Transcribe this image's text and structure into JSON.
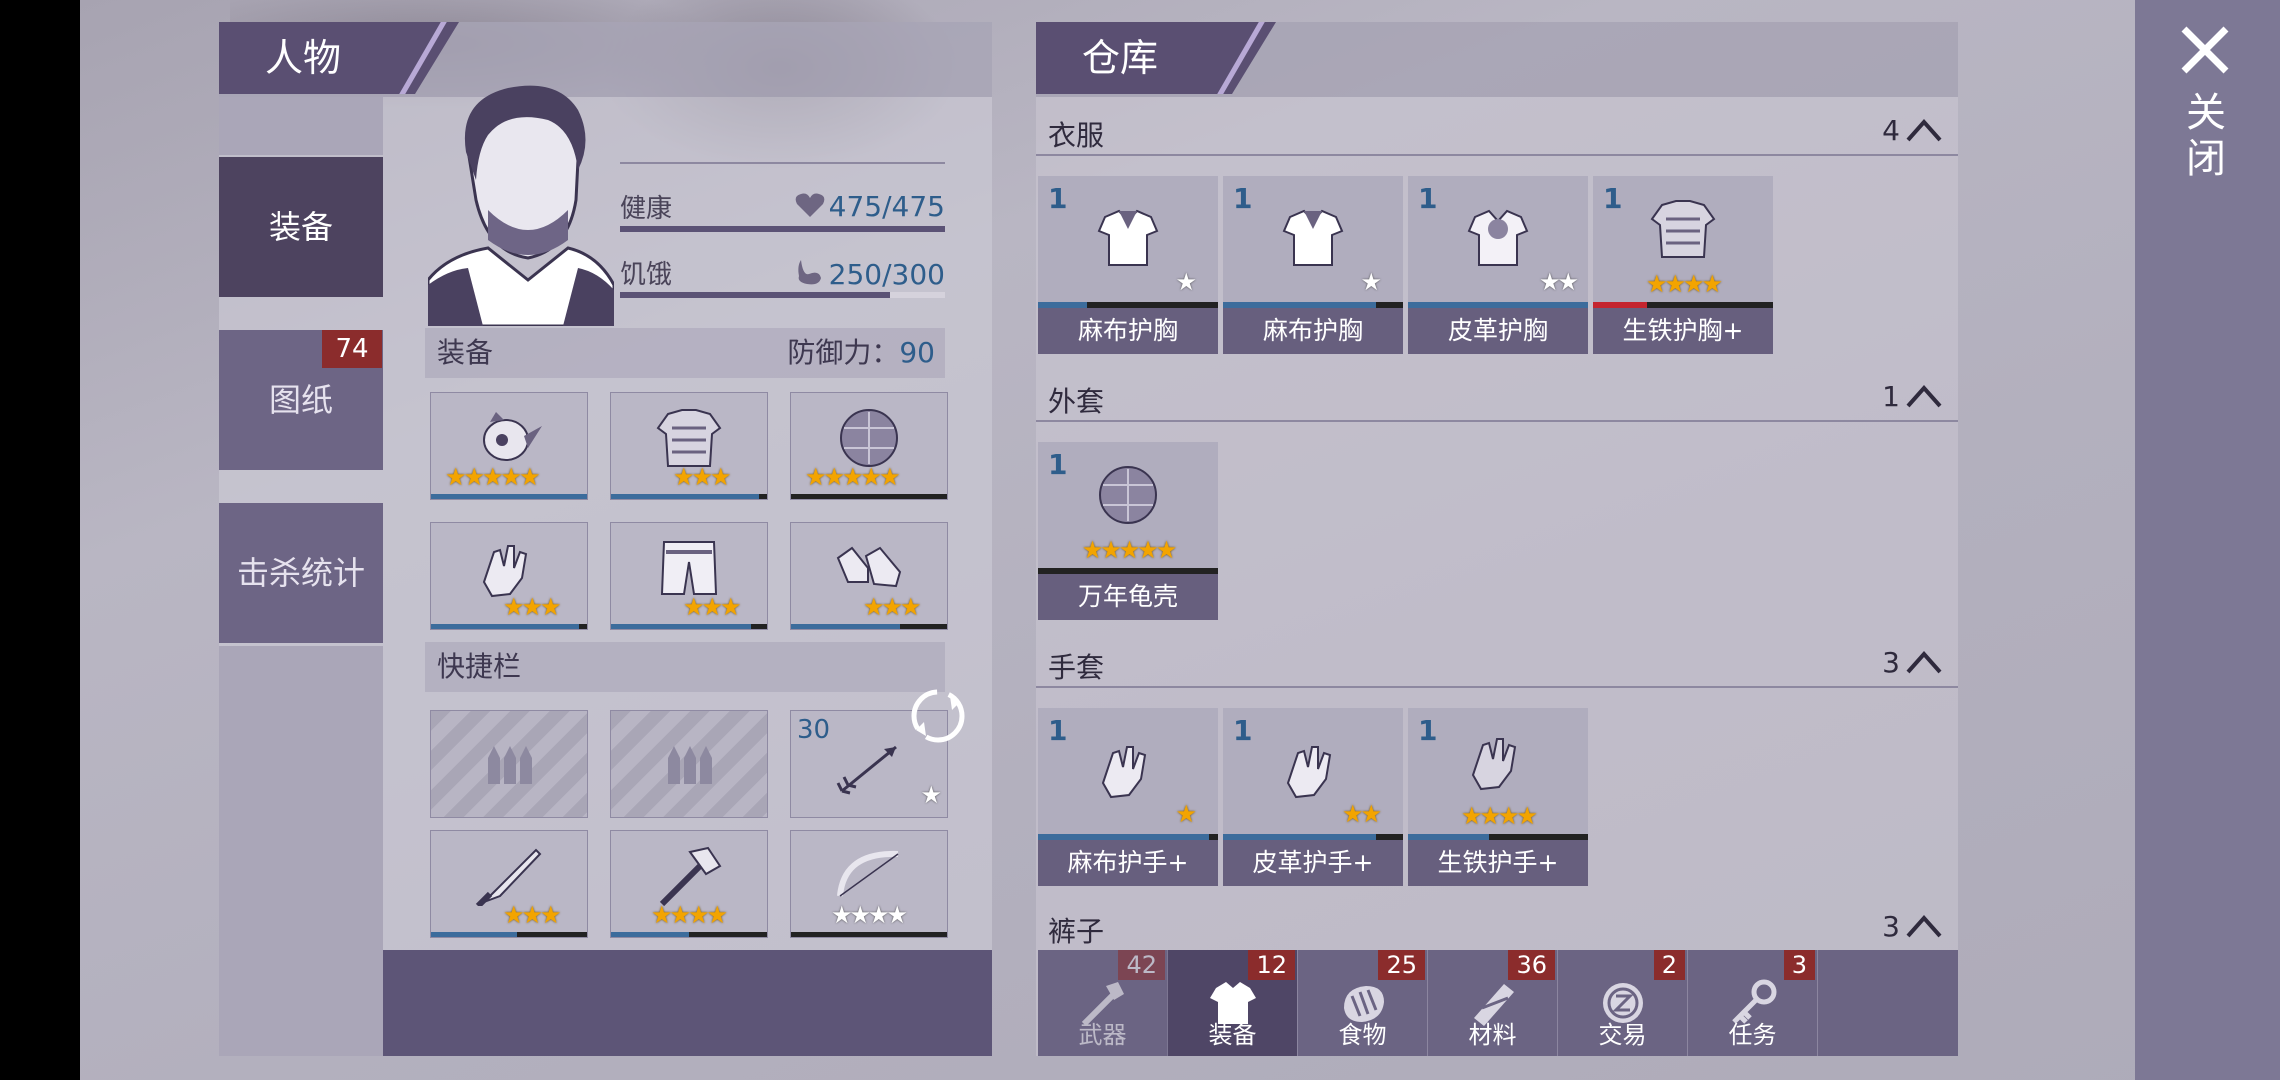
{
  "character": {
    "title": "人物",
    "tabs": [
      {
        "label": "装备"
      },
      {
        "label": "图纸",
        "badge": "74"
      },
      {
        "label": "击杀统计"
      }
    ],
    "stats": {
      "health": {
        "label": "健康",
        "value": "475/475",
        "level": 1.0
      },
      "hunger": {
        "label": "饥饿",
        "value": "250/300",
        "level": 0.833
      }
    },
    "equipment": {
      "label": "装备",
      "defense_label": "防御力：",
      "defense_value": "90",
      "slots": [
        {
          "icon": "bird-helmet-icon",
          "stars": "★★★★★"
        },
        {
          "icon": "chest-armor-icon",
          "stars": "★★★"
        },
        {
          "icon": "turtle-shell-icon",
          "stars": "★★★★★"
        },
        {
          "icon": "gloves-icon",
          "stars": "★★★"
        },
        {
          "icon": "pants-icon",
          "stars": "★★★"
        },
        {
          "icon": "shoes-icon",
          "stars": "★★★"
        }
      ]
    },
    "quickbar": {
      "label": "快捷栏",
      "slots": [
        {
          "icon": "ammo-placeholder-icon"
        },
        {
          "icon": "ammo-placeholder-icon"
        },
        {
          "icon": "arrow-icon",
          "count": "30",
          "stars": "★"
        },
        {
          "icon": "machete-icon",
          "stars": "★★★"
        },
        {
          "icon": "axe-icon",
          "stars": "★★★★"
        },
        {
          "icon": "bow-icon",
          "stars": "★★★★"
        }
      ]
    }
  },
  "storage": {
    "title": "仓库",
    "categories": [
      {
        "name": "衣服",
        "count": "4",
        "items": [
          {
            "qty": "1",
            "name": "麻布护胸",
            "stars": "★"
          },
          {
            "qty": "1",
            "name": "麻布护胸",
            "stars": "★"
          },
          {
            "qty": "1",
            "name": "皮革护胸",
            "stars": "★★"
          },
          {
            "qty": "1",
            "name": "生铁护胸+",
            "stars": "★★★★"
          }
        ]
      },
      {
        "name": "外套",
        "count": "1",
        "items": [
          {
            "qty": "1",
            "name": "万年龟壳",
            "stars": "★★★★★"
          }
        ]
      },
      {
        "name": "手套",
        "count": "3",
        "items": [
          {
            "qty": "1",
            "name": "麻布护手+",
            "stars": "★"
          },
          {
            "qty": "1",
            "name": "皮革护手+",
            "stars": "★★"
          },
          {
            "qty": "1",
            "name": "生铁护手+",
            "stars": "★★★★"
          }
        ]
      },
      {
        "name": "裤子",
        "count": "3",
        "items": []
      }
    ],
    "bottom_tabs": [
      {
        "label": "武器",
        "badge": "42",
        "icon": "hatchet-icon"
      },
      {
        "label": "装备",
        "badge": "12",
        "icon": "shirt-icon"
      },
      {
        "label": "食物",
        "badge": "25",
        "icon": "meat-icon"
      },
      {
        "label": "材料",
        "badge": "36",
        "icon": "wood-logs-icon"
      },
      {
        "label": "交易",
        "badge": "2",
        "icon": "coin-icon"
      },
      {
        "label": "任务",
        "badge": "3",
        "icon": "key-icon"
      }
    ]
  },
  "close": {
    "label": "关闭"
  },
  "colors": {
    "panel_dark": "#5a4f72",
    "value_blue": "#2e5d8b",
    "star_gold": "#f3a400",
    "badge_red": "#8b2c2c",
    "durability_low": "#c4242e"
  }
}
